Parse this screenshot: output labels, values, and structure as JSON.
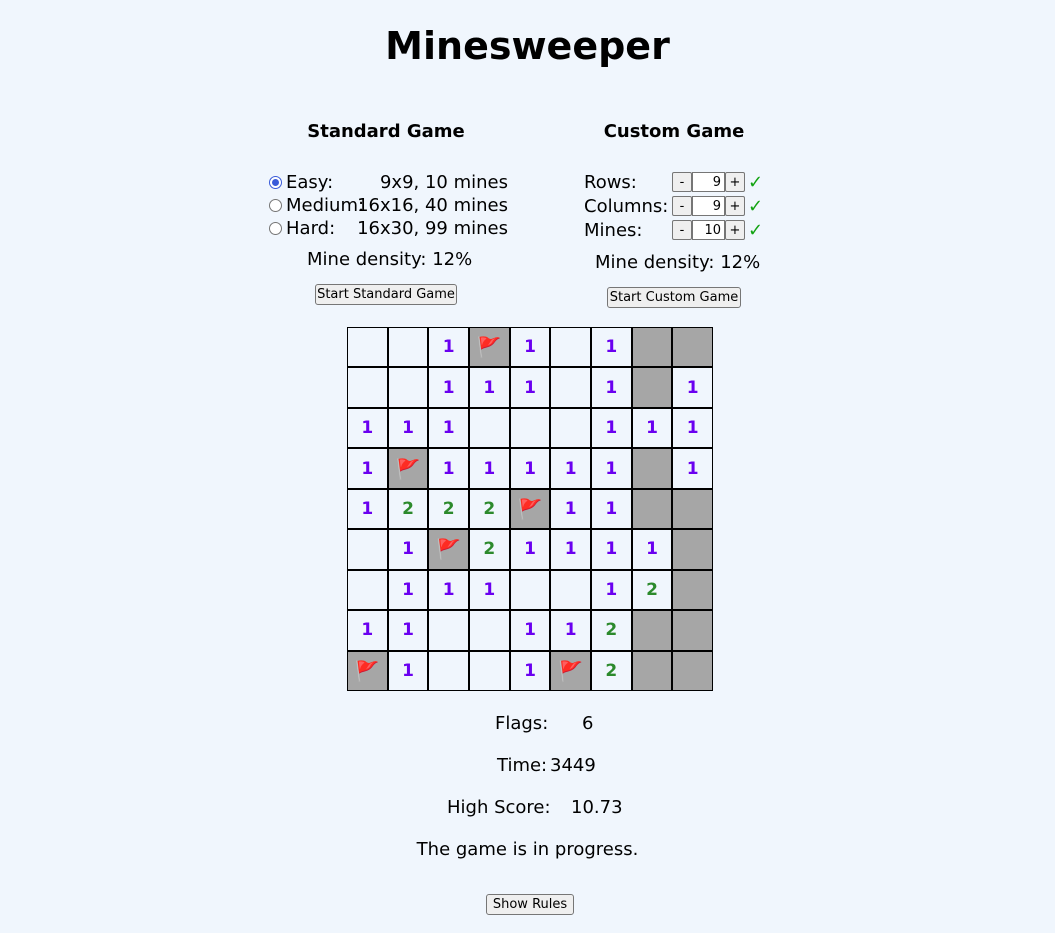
{
  "title": "Minesweeper",
  "standard": {
    "title": "Standard Game",
    "options": [
      {
        "label": "Easy:",
        "desc": "9x9, 10 mines",
        "checked": true
      },
      {
        "label": "Medium:",
        "desc": "16x16, 40 mines",
        "checked": false
      },
      {
        "label": "Hard:",
        "desc": "16x30, 99 mines",
        "checked": false
      }
    ],
    "density": "Mine density: 12%",
    "start_label": "Start Standard Game"
  },
  "custom": {
    "title": "Custom Game",
    "rows_label": "Rows:",
    "rows_value": "9",
    "columns_label": "Columns:",
    "columns_value": "9",
    "mines_label": "Mines:",
    "mines_value": "10",
    "minus": "-",
    "plus": "+",
    "valid_mark": "✓",
    "density": "Mine density: 12%",
    "start_label": "Start Custom Game"
  },
  "board": [
    [
      "",
      "",
      "1",
      "F",
      "1",
      "",
      "1",
      "H",
      "H"
    ],
    [
      "",
      "",
      "1",
      "1",
      "1",
      "",
      "1",
      "H",
      "1"
    ],
    [
      "1",
      "1",
      "1",
      "",
      "",
      "",
      "1",
      "1",
      "1"
    ],
    [
      "1",
      "F",
      "1",
      "1",
      "1",
      "1",
      "1",
      "H",
      "1"
    ],
    [
      "1",
      "2",
      "2",
      "2",
      "F",
      "1",
      "1",
      "H",
      "H"
    ],
    [
      "",
      "1",
      "F",
      "2",
      "1",
      "1",
      "1",
      "1",
      "H"
    ],
    [
      "",
      "1",
      "1",
      "1",
      "",
      "",
      "1",
      "2",
      "H"
    ],
    [
      "1",
      "1",
      "",
      "",
      "1",
      "1",
      "2",
      "H",
      "H"
    ],
    [
      "F",
      "1",
      "",
      "",
      "1",
      "F",
      "2",
      "H",
      "H"
    ]
  ],
  "flag_glyph": "🚩",
  "status": {
    "flags_label": "Flags:",
    "flags_value": "6",
    "time_label": "Time:",
    "time_value": "3449",
    "high_label": "High Score:",
    "high_value": "10.73",
    "message": "The game is in progress."
  },
  "rules_label": "Show Rules",
  "colors": {
    "background": "#f0f6fd",
    "hidden_cell": "#a6a6a6",
    "one": "#6a00f0",
    "two": "#2c8a2c",
    "valid": "#12a312"
  }
}
